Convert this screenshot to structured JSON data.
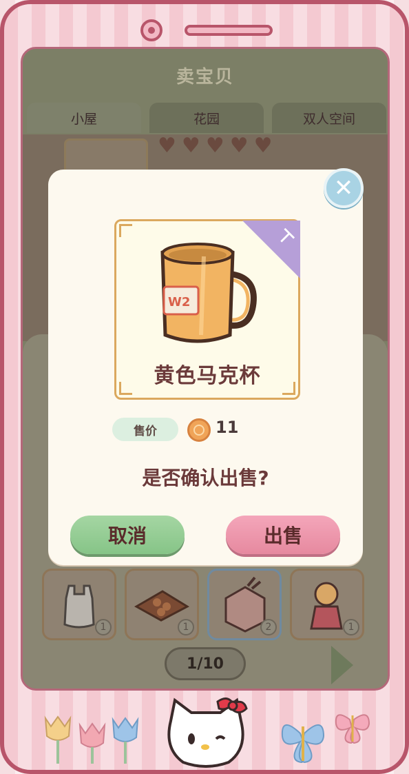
{
  "screen": {
    "title": "卖宝贝",
    "tabs": [
      {
        "label": "小屋",
        "active": true
      },
      {
        "label": "花园",
        "active": false
      },
      {
        "label": "双人空间",
        "active": false
      }
    ]
  },
  "inventory": {
    "items": [
      {
        "icon": "plastic-bag-icon",
        "count": "1"
      },
      {
        "icon": "cookie-tray-icon",
        "count": "1"
      },
      {
        "icon": "stationery-organizer-icon",
        "count": "2"
      },
      {
        "icon": "doll-icon",
        "count": "1"
      }
    ],
    "page": "1/10"
  },
  "dialog": {
    "item_name": "黄色马克杯",
    "price_label": "售价",
    "price_value": "11",
    "question": "是否确认出售?",
    "cancel_label": "取消",
    "sell_label": "出售"
  },
  "colors": {
    "phone_frame": "#b8556a",
    "cancel_button": "#86c487",
    "sell_button": "#e6899f",
    "item_title": "#6b3a3a",
    "card_border": "#dba85e"
  }
}
